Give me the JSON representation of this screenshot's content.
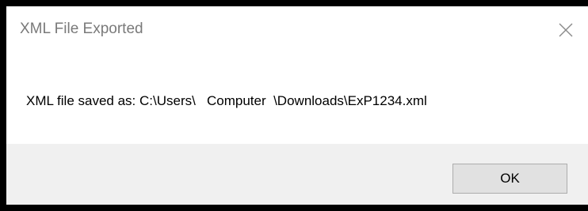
{
  "dialog": {
    "title": "XML File Exported",
    "close_icon": "close-icon",
    "message": "XML file saved as: C:\\Users\\   Computer  \\Downloads\\ExP1234.xml",
    "ok_label": "OK"
  },
  "colors": {
    "frame": "#000000",
    "dialog_background": "#ffffff",
    "title_text": "#7a7a7a",
    "footer_background": "#f0f0f0",
    "button_background": "#e1e1e1",
    "button_border": "#adadad"
  }
}
